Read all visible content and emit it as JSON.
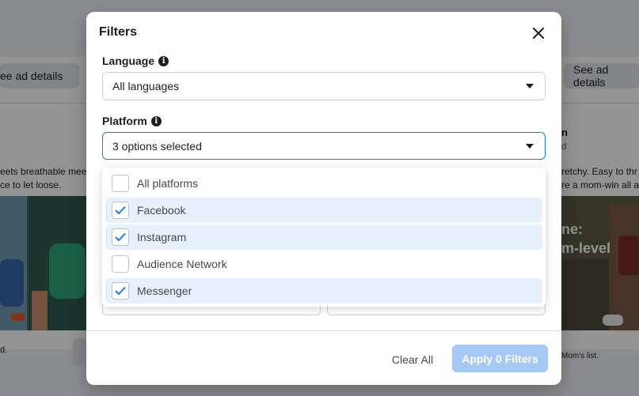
{
  "background": {
    "left_button": "ee ad details",
    "right_button": "See ad details",
    "left_text_1": "eets breathable meet",
    "left_text_2": "ce to let loose.",
    "right_title_fragment": "n",
    "right_sub_fragment": "d",
    "right_text_1": "retchy. Easy to thr",
    "right_text_2": "re a mom-win all a",
    "promo_line_1": "ne:",
    "promo_line_2": "m-level",
    "left_footer_text": "d.",
    "right_footer_text": "Mom's list."
  },
  "modal": {
    "title": "Filters",
    "language": {
      "label": "Language",
      "value": "All languages"
    },
    "platform": {
      "label": "Platform",
      "value": "3 options selected",
      "options": [
        {
          "label": "All platforms",
          "checked": false
        },
        {
          "label": "Facebook",
          "checked": true
        },
        {
          "label": "Instagram",
          "checked": true
        },
        {
          "label": "Audience Network",
          "checked": false
        },
        {
          "label": "Messenger",
          "checked": true
        }
      ]
    },
    "footer": {
      "clear_label": "Clear All",
      "apply_label": "Apply 0 Filters"
    }
  },
  "colors": {
    "accent": "#1877f2",
    "apply_disabled": "#a6c8f5",
    "option_selected_bg": "#e7f0fd"
  }
}
